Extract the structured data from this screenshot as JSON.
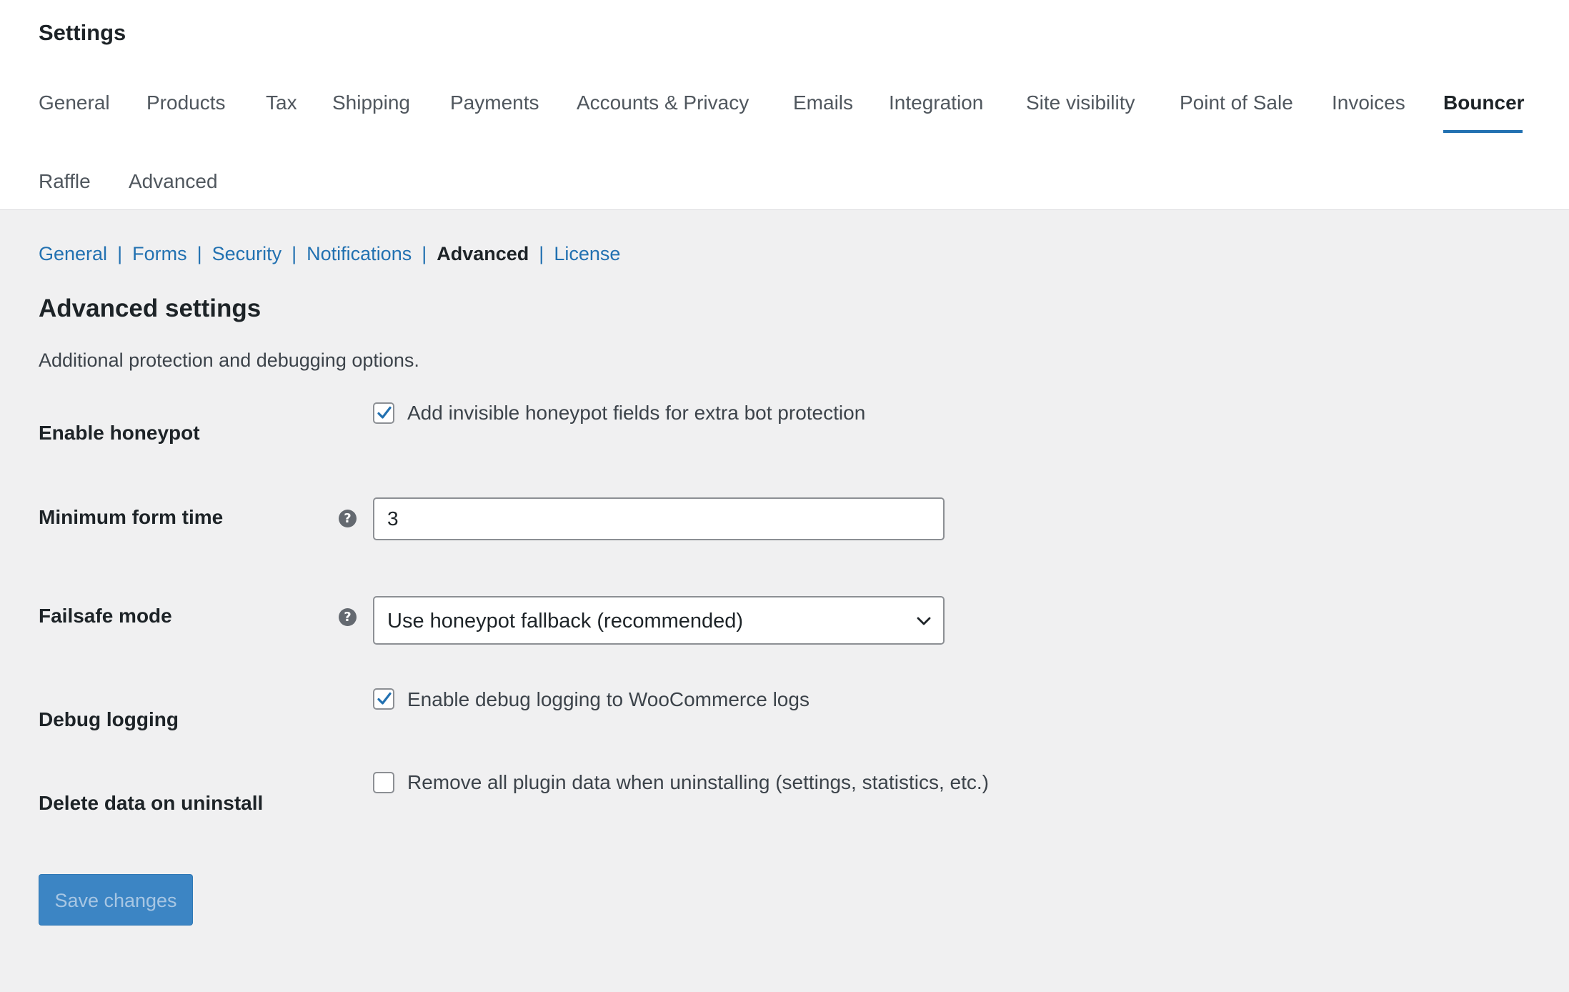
{
  "page": {
    "title": "Settings"
  },
  "main_tabs": [
    {
      "label": "General",
      "active": false
    },
    {
      "label": "Products",
      "active": false
    },
    {
      "label": "Tax",
      "active": false
    },
    {
      "label": "Shipping",
      "active": false
    },
    {
      "label": "Payments",
      "active": false
    },
    {
      "label": "Accounts & Privacy",
      "active": false
    },
    {
      "label": "Emails",
      "active": false
    },
    {
      "label": "Integration",
      "active": false
    },
    {
      "label": "Site visibility",
      "active": false
    },
    {
      "label": "Point of Sale",
      "active": false
    },
    {
      "label": "Invoices",
      "active": false
    },
    {
      "label": "Bouncer",
      "active": true
    },
    {
      "label": "Raffle",
      "active": false
    },
    {
      "label": "Advanced",
      "active": false
    }
  ],
  "subnav": {
    "separator": "|",
    "items": [
      {
        "label": "General",
        "current": false
      },
      {
        "label": "Forms",
        "current": false
      },
      {
        "label": "Security",
        "current": false
      },
      {
        "label": "Notifications",
        "current": false
      },
      {
        "label": "Advanced",
        "current": true
      },
      {
        "label": "License",
        "current": false
      }
    ]
  },
  "section": {
    "title": "Advanced settings",
    "description": "Additional protection and debugging options."
  },
  "fields": {
    "honeypot": {
      "label": "Enable honeypot",
      "checkbox_text": "Add invisible honeypot fields for extra bot protection",
      "checked": true
    },
    "min_form_time": {
      "label": "Minimum form time",
      "value": "3",
      "help_icon": "question-circle-icon"
    },
    "failsafe": {
      "label": "Failsafe mode",
      "selected": "Use honeypot fallback (recommended)",
      "help_icon": "question-circle-icon"
    },
    "debug_logging": {
      "label": "Debug logging",
      "checkbox_text": "Enable debug logging to WooCommerce logs",
      "checked": true
    },
    "delete_data": {
      "label": "Delete data on uninstall",
      "checkbox_text": "Remove all plugin data when uninstalling (settings, statistics, etc.)",
      "checked": false
    }
  },
  "actions": {
    "save_label": "Save changes"
  },
  "colors": {
    "accent": "#2271b1",
    "background": "#f0f0f1",
    "save_button": "#3c85c4"
  }
}
